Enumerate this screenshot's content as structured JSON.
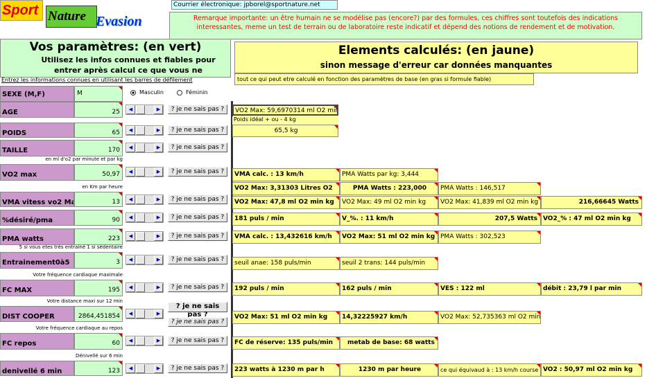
{
  "header": {
    "logo_sport": "Sport",
    "logo_nature": "Nature",
    "logo_evasion": "Evasion",
    "email": "Courrier électronique: jpborel@sportnature.net",
    "remark": "Remarque importante: un être humain ne se modélise pas (encore?) par des formules, ces chiffres sont toutefois des indications interessantes, meme un test de terrain ou de laboratoire reste indicatif et dépend des notions de rendement et de motivation."
  },
  "left": {
    "title": "Vos paramètres: (en vert)",
    "subtitle": "Utilisez les infos connues et fiables pour entrer après calcul ce que vous ne connaissez pas",
    "instruction": "Entrez les informations connues en utilisant les barres de défilement"
  },
  "right": {
    "title": "Elements calculés: (en jaune)",
    "subtitle": "sinon message d'erreur car données manquantes",
    "note": "tout ce qui peut etre calculé en fonction des paramètres de base (en gras si formule fiable)"
  },
  "sexe": {
    "label": "SEXE (M,F)",
    "value": "M",
    "masculin": "Masculin",
    "feminin": "Féminin"
  },
  "unknown_button": "? je ne sais pas ?",
  "rows": [
    {
      "label": "AGE",
      "value": "25",
      "note": ""
    },
    {
      "label": "POIDS",
      "value": "65",
      "note": ""
    },
    {
      "label": "TAILLE",
      "value": "170",
      "note": ""
    },
    {
      "label": "VO2 max",
      "value": "50,97",
      "note": "en ml d'o2 par minute et par kg"
    },
    {
      "label": "VMA vitess vo2 Max",
      "value": "13",
      "note": "en Km par heure"
    },
    {
      "label": "%désiré/pma",
      "value": "90",
      "note": ""
    },
    {
      "label": "PMA watts",
      "value": "223",
      "note": ""
    },
    {
      "label": "Entrainement0à5",
      "value": "3",
      "note": "5 si vous etes très entrainé 1 si sédentaire"
    },
    {
      "label": "FC MAX",
      "value": "195",
      "note": "Votre fréquence cardiaque maximale"
    },
    {
      "label": "DIST COOPER",
      "value": "2864,451854",
      "note": "Votre distance maxi sur 12 min"
    },
    {
      "label": "FC repos",
      "value": "60",
      "note": "Votre fréquence cardiaque au repos"
    },
    {
      "label": "denivellé 6 min",
      "value": "123",
      "note": "Dénivellé sur 6 min"
    }
  ],
  "results": {
    "age_vo2": "VO2 Max: 59,6970314  ml O2 min kg",
    "poids_ideal_label": "Poids idéal + ou - 4 kg",
    "poids_ideal": "65,5  kg",
    "vo2_a": "VMA calc. : 13 km/h",
    "vo2_b": "PMA Watts par kg: 3,444",
    "vma_top_a": "VO2 Max: 3,31303  Litres O2",
    "vma_top_b": "PMA Watts : 223,000",
    "vma_top_c": "PMA Watts : 146,517",
    "vma_a": "VO2 Max: 47,8  ml O2 min kg",
    "vma_b": "VO2 Max: 49  ml O2 min kg",
    "vma_c": "VO2 Max: 41,839  ml O2 min kg",
    "vma_d": "216,66645  Watts",
    "pct_a": "181 puls / min",
    "pct_b": "V_%. : 11 km/h",
    "pct_c": "207,5  Watts",
    "pct_d": "VO2_% : 47  ml O2 min kg",
    "pma_a": "VMA calc. : 13,432616 km/h",
    "pma_b": "VO2 Max: 51  ml O2 min kg",
    "pma_c": "PMA Watts : 302,523",
    "ent_a": "seuil anae: 158 puls/min",
    "ent_b": "seuil 2 trans: 144  puls/min",
    "fc_a": "192 puls / min",
    "fc_b": "162 puls / min",
    "fc_c": "VES : 122  ml",
    "fc_d": "débit : 23,79  l par min",
    "cooper_a": "VO2 Max: 51  ml O2 min kg",
    "cooper_b": "14,32225927 km/h",
    "cooper_c": "VO2 Max: 52,735363  ml O2 min kg",
    "rep_a": "FC de réserve: 135  puls/min",
    "rep_b": "metab de base:  68  watts",
    "den_a": "223 watts à 1230 m par h",
    "den_b": "1230  m par heure",
    "den_c": "ce qui équivaud à : 13 km/h course",
    "den_d": "VO2 : 50,97  ml O2 min kg"
  },
  "colors": {
    "input": "#ccffcc",
    "label": "#cc99cc",
    "result": "#ffff99",
    "accent": "#ff0000"
  },
  "icons": [
    "scroll-left-icon",
    "scroll-right-icon",
    "radio-icon",
    "comment-indicator-icon"
  ]
}
